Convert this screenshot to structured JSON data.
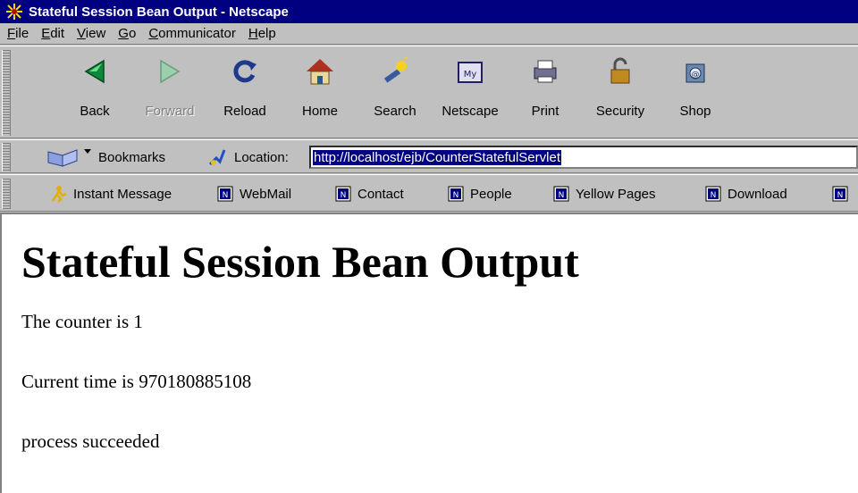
{
  "window": {
    "title": "Stateful Session Bean Output - Netscape"
  },
  "menu": [
    "File",
    "Edit",
    "View",
    "Go",
    "Communicator",
    "Help"
  ],
  "toolbar": {
    "buttons": [
      {
        "label": "Back",
        "icon": "back-arrow-icon",
        "enabled": true
      },
      {
        "label": "Forward",
        "icon": "forward-arrow-icon",
        "enabled": false
      },
      {
        "label": "Reload",
        "icon": "reload-icon",
        "enabled": true
      },
      {
        "label": "Home",
        "icon": "home-icon",
        "enabled": true
      },
      {
        "label": "Search",
        "icon": "search-icon",
        "enabled": true
      },
      {
        "label": "Netscape",
        "icon": "my-netscape-icon",
        "enabled": true
      },
      {
        "label": "Print",
        "icon": "print-icon",
        "enabled": true
      },
      {
        "label": "Security",
        "icon": "lock-icon",
        "enabled": true
      },
      {
        "label": "Shop",
        "icon": "shop-icon",
        "enabled": true
      }
    ]
  },
  "location": {
    "bookmarks_label": "Bookmarks",
    "location_label": "Location:",
    "url": "http://localhost/ejb/CounterStatefulServlet"
  },
  "personal_toolbar": {
    "items": [
      "Instant Message",
      "WebMail",
      "Contact",
      "People",
      "Yellow Pages",
      "Download"
    ]
  },
  "page": {
    "heading": "Stateful Session Bean Output",
    "lines": [
      "The counter is 1",
      "Current time is 970180885108",
      "process succeeded"
    ]
  },
  "colors": {
    "titlebar": "#000080",
    "chrome": "#c0c0c0",
    "selection": "#000080"
  }
}
